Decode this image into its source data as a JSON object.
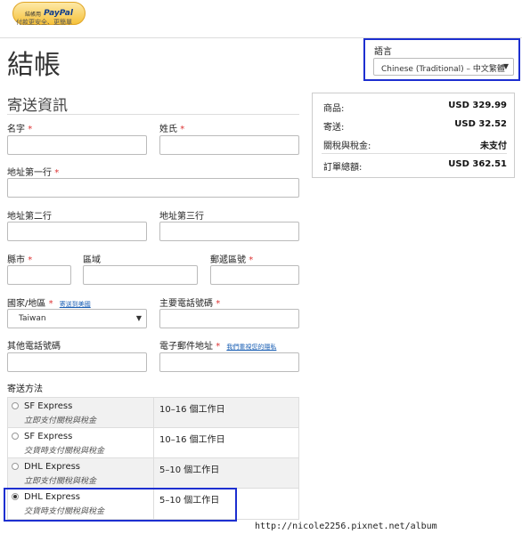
{
  "paypal": {
    "prefix": "結帳用",
    "logo": "PayPal",
    "tagline": "付款更安全、更簡單"
  },
  "page_title": "結帳",
  "language": {
    "label": "語言",
    "selected": "Chinese (Traditional) – 中文繁體"
  },
  "shipping_info_title": "寄送資訊",
  "summary": [
    {
      "label": "商品:",
      "value": "USD 329.99"
    },
    {
      "label": "寄送:",
      "value": "USD 32.52"
    },
    {
      "label": "關稅與稅金:",
      "value": "未支付"
    },
    {
      "label": "訂單總額:",
      "value": "USD 362.51"
    }
  ],
  "fields": {
    "first_name": "名字",
    "last_name": "姓氏",
    "address1": "地址第一行",
    "address2": "地址第二行",
    "address3": "地址第三行",
    "city": "縣市",
    "district": "區域",
    "postal": "郵遞區號",
    "country": "國家/地區",
    "ship_to_us_link": "寄送到美國",
    "country_value": "Taiwan",
    "primary_phone": "主要電話號碼",
    "other_phone": "其他電話號碼",
    "email": "電子郵件地址",
    "privacy_link": "我們重視您的隱私"
  },
  "required_mark": "*",
  "shipping_method_label": "寄送方法",
  "shipping_options": [
    {
      "name": "SF Express",
      "note": "立即支付關稅與稅金",
      "days": "10–16 個工作日",
      "selected": false
    },
    {
      "name": "SF Express",
      "note": "交貨時支付關稅與稅金",
      "days": "10–16 個工作日",
      "selected": false
    },
    {
      "name": "DHL Express",
      "note": "立即支付關稅與稅金",
      "days": "5–10 個工作日",
      "selected": false
    },
    {
      "name": "DHL Express",
      "note": "交貨時支付關稅與稅金",
      "days": "5–10 個工作日",
      "selected": true
    }
  ],
  "watermark": "http://nicole2256.pixnet.net/album"
}
